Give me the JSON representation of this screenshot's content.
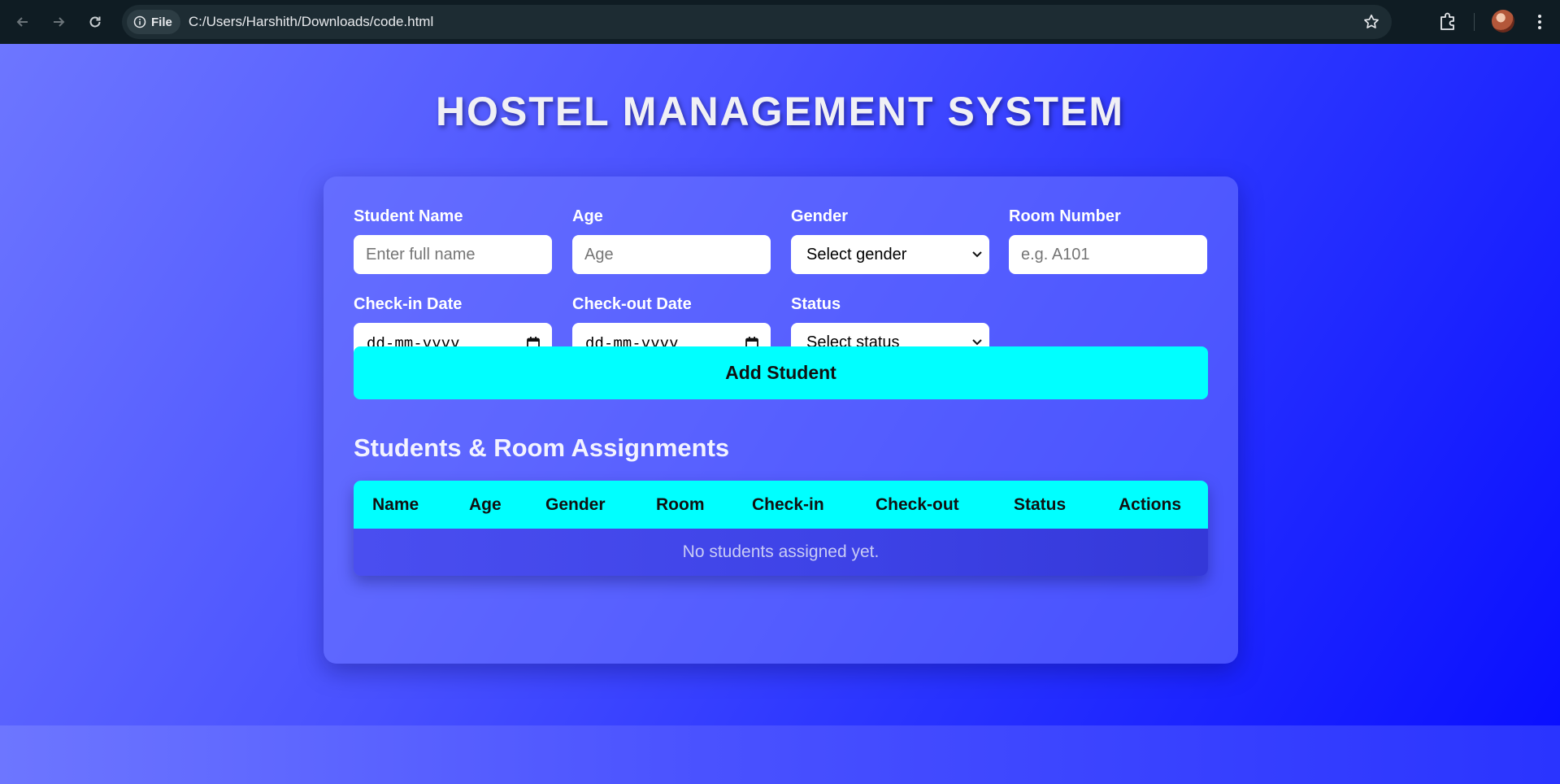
{
  "browser": {
    "chip_label": "File",
    "url": "C:/Users/Harshith/Downloads/code.html"
  },
  "page": {
    "title": "HOSTEL MANAGEMENT SYSTEM"
  },
  "form": {
    "student_name": {
      "label": "Student Name",
      "placeholder": "Enter full name"
    },
    "age": {
      "label": "Age",
      "placeholder": "Age"
    },
    "gender": {
      "label": "Gender",
      "value": "Select gender"
    },
    "room_number": {
      "label": "Room Number",
      "placeholder": "e.g. A101"
    },
    "check_in": {
      "label": "Check-in Date",
      "value": "dd-mm-yyyy"
    },
    "check_out": {
      "label": "Check-out Date",
      "value": "dd-mm-yyyy"
    },
    "status": {
      "label": "Status",
      "value": "Select status"
    },
    "submit_label": "Add Student"
  },
  "table": {
    "title": "Students & Room Assignments",
    "columns": [
      "Name",
      "Age",
      "Gender",
      "Room",
      "Check-in",
      "Check-out",
      "Status",
      "Actions"
    ],
    "empty_message": "No students assigned yet."
  },
  "colors": {
    "accent": "#00ffff",
    "chrome": "#0f1c23",
    "background_start": "#6d76ff",
    "background_end": "#0a0fff"
  }
}
